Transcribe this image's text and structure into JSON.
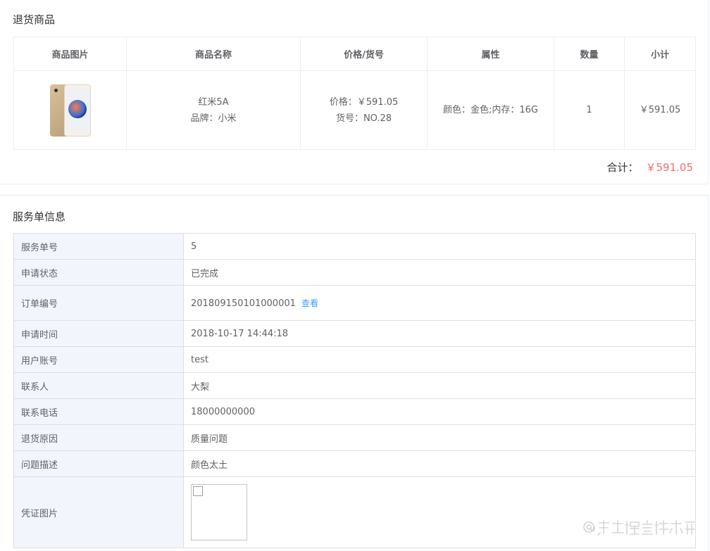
{
  "goods_section": {
    "title": "退货商品",
    "headers": [
      "商品图片",
      "商品名称",
      "价格/货号",
      "属性",
      "数量",
      "小计"
    ],
    "item": {
      "image_icon": "phone-product-image",
      "name": "红米5A",
      "brand": "品牌：小米",
      "price": "价格：￥591.05",
      "sku": "货号：NO.28",
      "attributes": "颜色：金色;内存：16G",
      "quantity": "1",
      "subtotal": "￥591.05"
    },
    "total_label": "合计：",
    "total_value": "￥591.05",
    "total_color": "#f56c6c"
  },
  "service_section": {
    "title": "服务单信息",
    "rows": [
      {
        "label": "服务单号",
        "value": "5"
      },
      {
        "label": "申请状态",
        "value": "已完成"
      },
      {
        "label": "订单编号",
        "value": "201809150101000001",
        "link": "查看"
      },
      {
        "label": "申请时间",
        "value": "2018-10-17 14:44:18"
      },
      {
        "label": "用户账号",
        "value": "test"
      },
      {
        "label": "联系人",
        "value": "大梨"
      },
      {
        "label": "联系电话",
        "value": "18000000000"
      },
      {
        "label": "退货原因",
        "value": "质量问题"
      },
      {
        "label": "问题描述",
        "value": "颜色太土"
      },
      {
        "label": "凭证图片",
        "value": ""
      }
    ],
    "label_bg": "#f2f6fc",
    "link_color": "#409eff"
  },
  "watermark": "@稀土掘金技术社区"
}
